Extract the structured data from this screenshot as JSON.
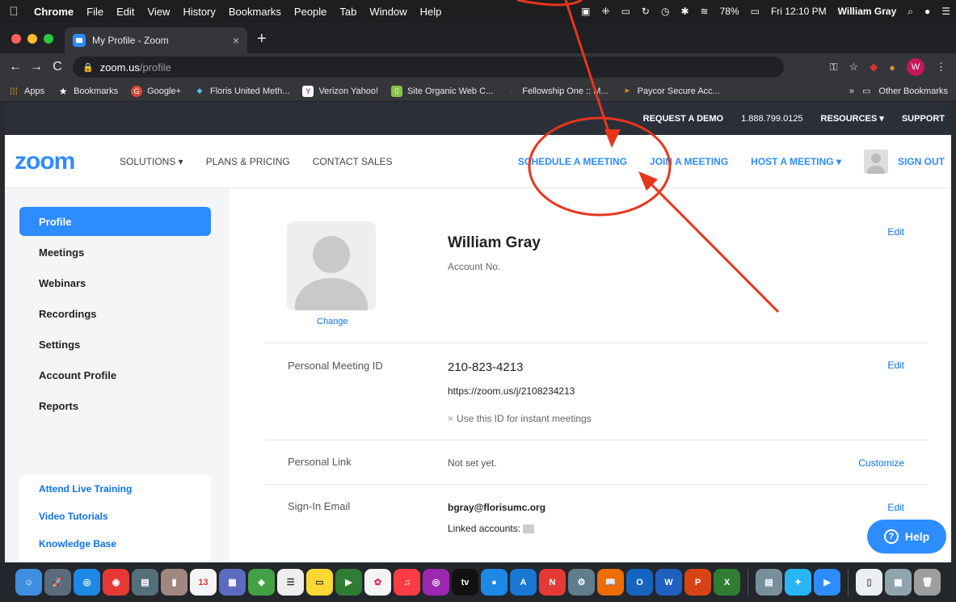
{
  "menubar": {
    "apple": "",
    "items": [
      "Chrome",
      "File",
      "Edit",
      "View",
      "History",
      "Bookmarks",
      "People",
      "Tab",
      "Window",
      "Help"
    ],
    "battery": "78%",
    "clock": "Fri 12:10 PM",
    "user": "William Gray"
  },
  "browser": {
    "tab_title": "My Profile - Zoom",
    "url_host": "zoom.us",
    "url_path": "/profile",
    "profile_initial": "W"
  },
  "bookmarks": {
    "items": [
      "Apps",
      "Bookmarks",
      "Google+",
      "Floris United Meth...",
      "Verizon Yahoo!",
      "Site Organic Web C...",
      "Fellowship One :: M...",
      "Paycor Secure Acc..."
    ],
    "other": "Other Bookmarks",
    "overflow": "»"
  },
  "zoom": {
    "topbar": {
      "demo": "REQUEST A DEMO",
      "phone": "1.888.799.0125",
      "resources": "RESOURCES ▾",
      "support": "SUPPORT"
    },
    "logo": "zoom",
    "nav": {
      "solutions": "SOLUTIONS ▾",
      "plans": "PLANS & PRICING",
      "contact": "CONTACT SALES"
    },
    "actions": {
      "schedule": "SCHEDULE A MEETING",
      "join": "JOIN A MEETING",
      "host": "HOST A MEETING ▾",
      "signout": "SIGN OUT"
    },
    "sidebar": {
      "items": [
        "Profile",
        "Meetings",
        "Webinars",
        "Recordings",
        "Settings",
        "Account Profile",
        "Reports"
      ],
      "links": [
        "Attend Live Training",
        "Video Tutorials",
        "Knowledge Base"
      ]
    },
    "profile": {
      "name": "William Gray",
      "account_label": "Account No.",
      "change": "Change",
      "edit": "Edit",
      "pmi_label": "Personal Meeting ID",
      "pmi": "210-823-4213",
      "pmi_url": "https://zoom.us/j/2108234213",
      "pmi_option": "Use this ID for instant meetings",
      "link_label": "Personal Link",
      "link_value": "Not set yet.",
      "customize": "Customize",
      "email_label": "Sign-In Email",
      "email": "bgray@florisumc.org",
      "linked": "Linked accounts:"
    },
    "help": "Help"
  },
  "colors": {
    "accent": "#2d8cff",
    "annotation": "#e8351c"
  }
}
